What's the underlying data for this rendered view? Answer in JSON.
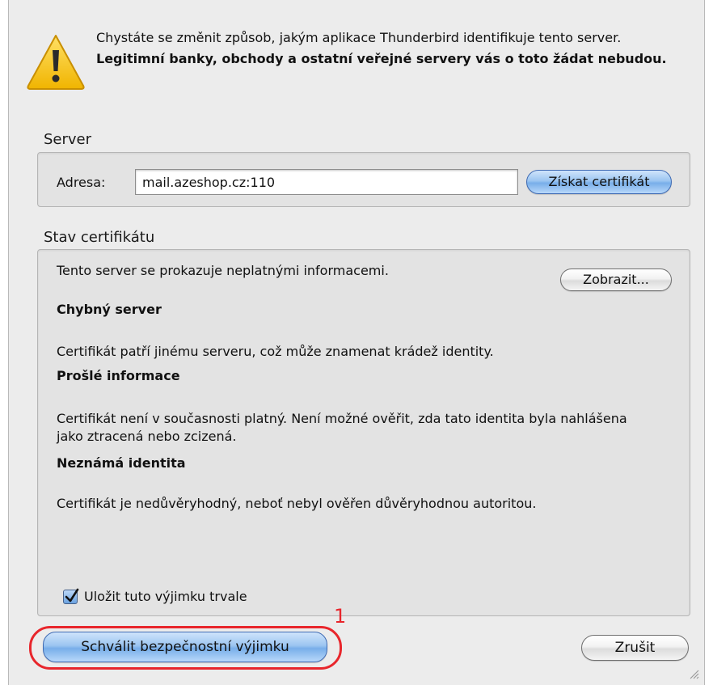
{
  "warning": {
    "icon": "warning-icon",
    "line1": "Chystáte se změnit způsob, jakým aplikace Thunderbird identifikuje tento server.",
    "line2": "Legitimní banky, obchody a ostatní veřejné servery vás o toto žádat nebudou."
  },
  "server": {
    "section_title": "Server",
    "address_label": "Adresa:",
    "address_value": "mail.azeshop.cz:110",
    "get_cert_button": "Získat certifikát"
  },
  "cert_status": {
    "section_title": "Stav certifikátu",
    "intro": "Tento server se prokazuje neplatnými informacemi.",
    "view_button": "Zobrazit...",
    "issues": [
      {
        "title": "Chybný server",
        "text": "Certifikát patří jinému serveru, což může znamenat krádež identity."
      },
      {
        "title": "Prošlé informace",
        "text": "Certifikát není v současnosti platný. Není možné ověřit, zda tato identita byla nahlášena jako ztracená nebo zcizená."
      },
      {
        "title": "Neznámá identita",
        "text": "Certifikát je nedůvěryhodný, neboť nebyl ověřen důvěryhodnou autoritou."
      }
    ],
    "save_permanently_label": "Uložit tuto výjimku trvale",
    "save_permanently_checked": true
  },
  "buttons": {
    "confirm": "Schválit bezpečnostní výjimku",
    "cancel": "Zrušit"
  },
  "annotation": {
    "number": "1",
    "color": "#e8262c"
  },
  "colors": {
    "accent_blue": "#78aee9",
    "dialog_bg": "#ececec"
  }
}
